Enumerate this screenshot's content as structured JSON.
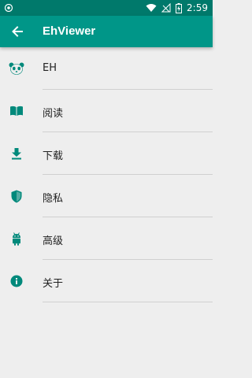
{
  "status_bar": {
    "time": "2:59"
  },
  "app_bar": {
    "title": "EhViewer",
    "back_icon": "arrow-back-icon"
  },
  "colors": {
    "primary": "#009688",
    "primary_dark": "#00796b",
    "background": "#eeeeee",
    "icon": "#00897b"
  },
  "settings": {
    "items": [
      {
        "label": "EH",
        "icon": "panda-icon"
      },
      {
        "label": "阅读",
        "icon": "book-icon"
      },
      {
        "label": "下载",
        "icon": "download-icon"
      },
      {
        "label": "隐私",
        "icon": "shield-icon"
      },
      {
        "label": "高级",
        "icon": "android-icon"
      },
      {
        "label": "关于",
        "icon": "info-icon"
      }
    ]
  }
}
